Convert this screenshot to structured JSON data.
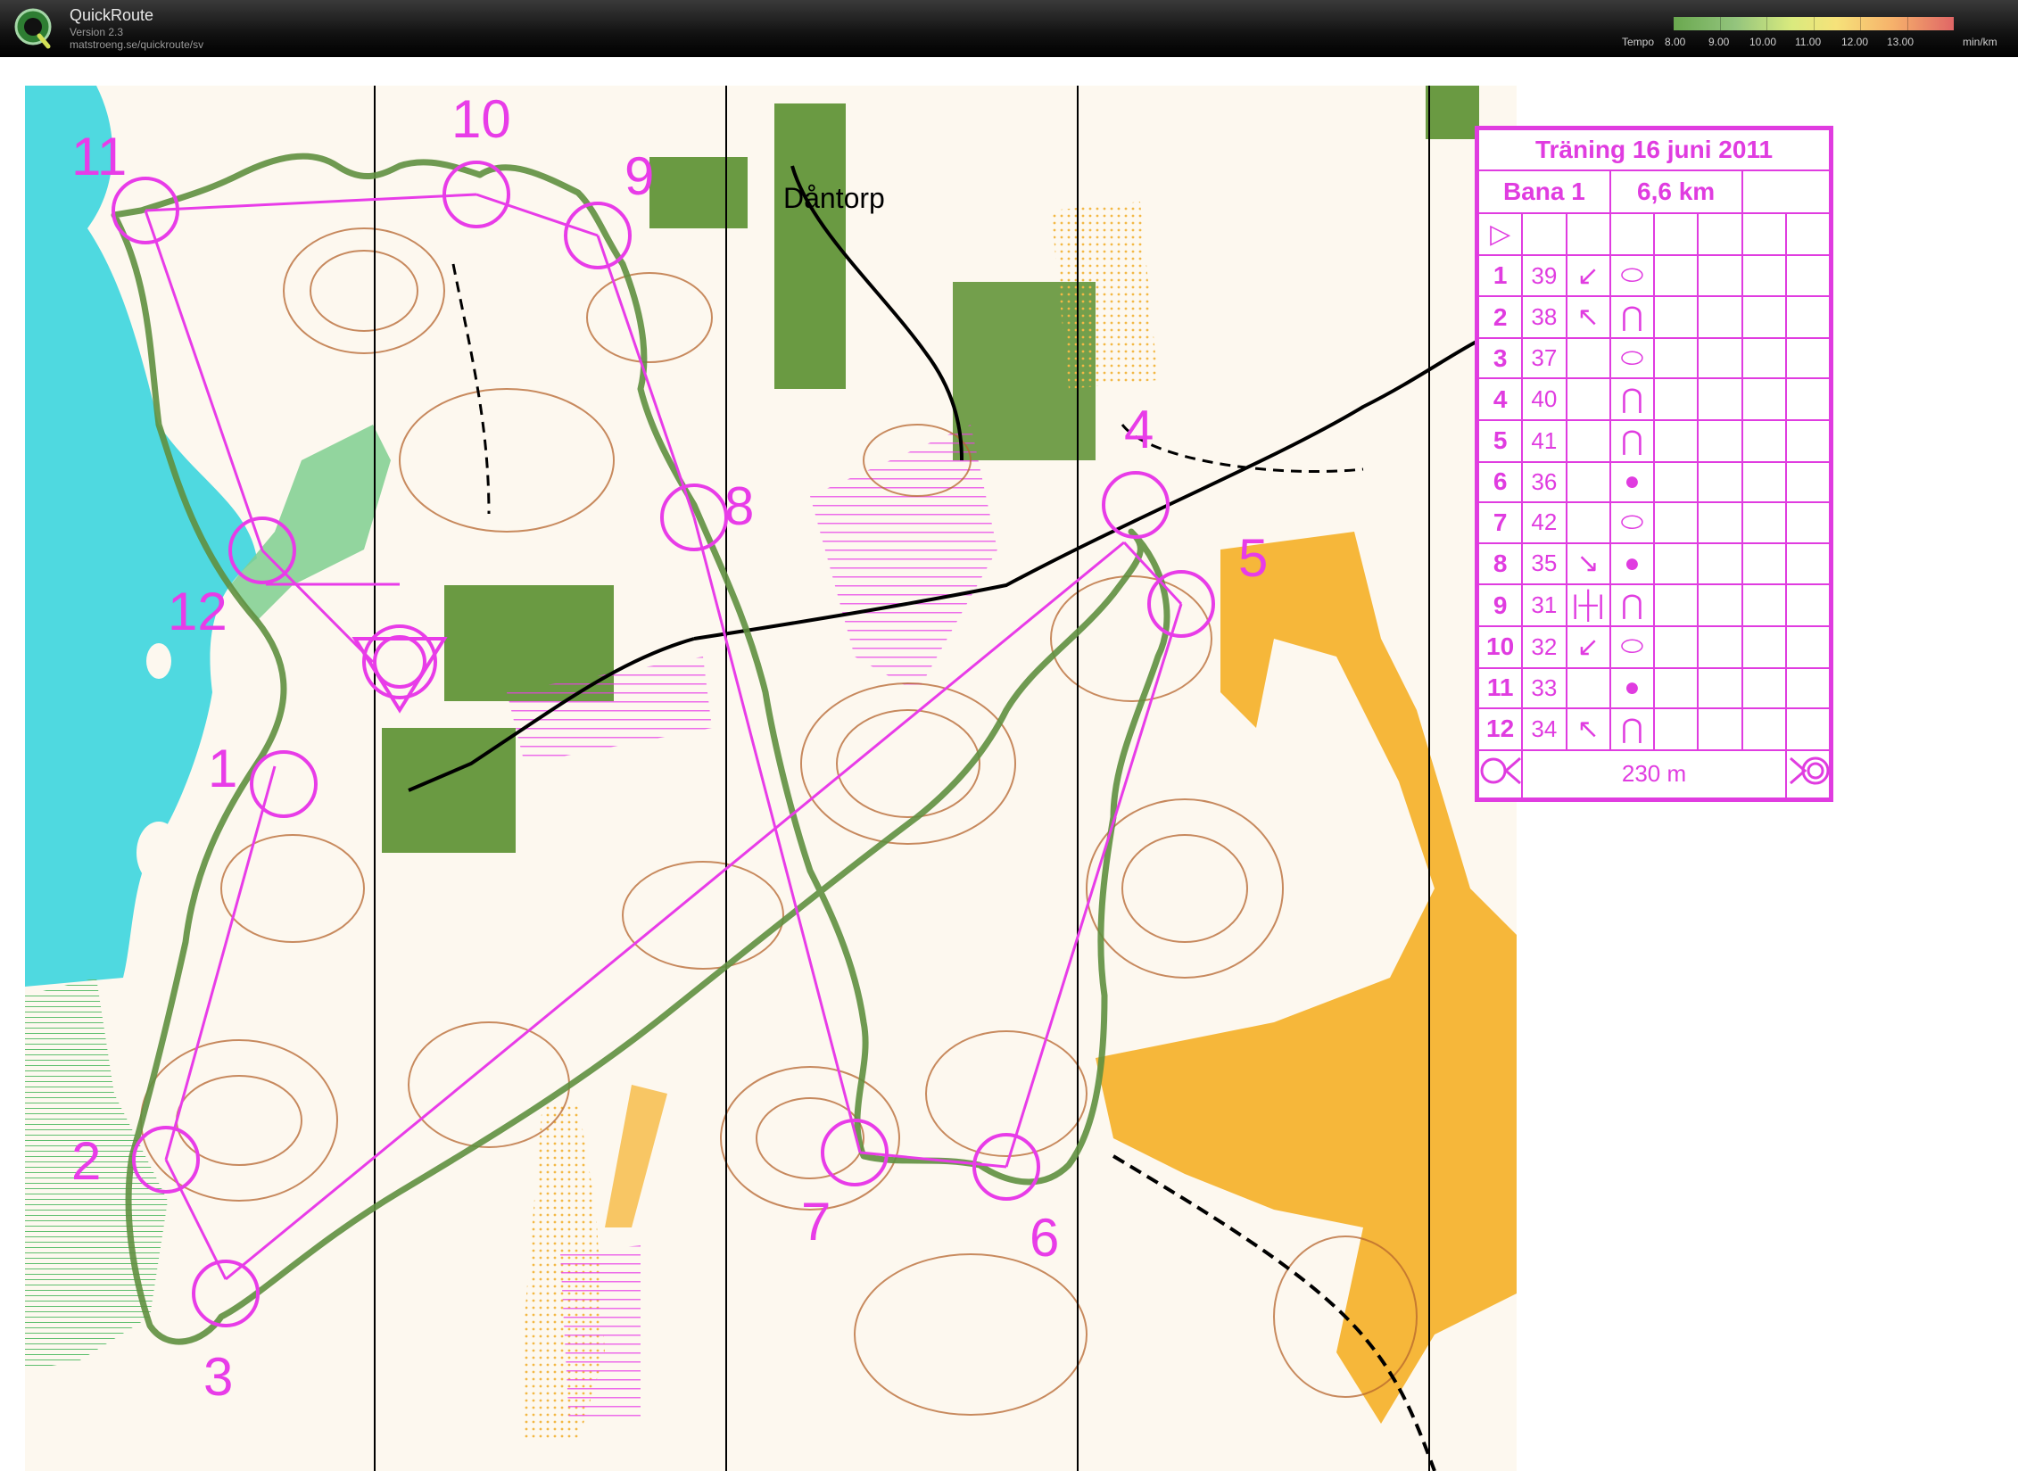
{
  "app": {
    "title": "QuickRoute",
    "version": "Version 2.3",
    "url": "matstroeng.se/quickroute/sv",
    "logo_letter": "Q"
  },
  "legend": {
    "label": "Tempo",
    "ticks": [
      "8.00",
      "9.00",
      "10.00",
      "11.00",
      "12.00",
      "13.00"
    ],
    "unit": "min/km",
    "colors": [
      "#6aa84f",
      "#93c47d",
      "#d9ea7e",
      "#f6e27a",
      "#f6b26b",
      "#e06666"
    ]
  },
  "map": {
    "place_name": "Dåntorp",
    "course_color": "#e83ce8",
    "route_color": "#5a8a3a",
    "water_color": "#4fd9e0",
    "controls": [
      {
        "label": "1"
      },
      {
        "label": "2"
      },
      {
        "label": "3"
      },
      {
        "label": "4"
      },
      {
        "label": "5"
      },
      {
        "label": "6"
      },
      {
        "label": "7"
      },
      {
        "label": "8"
      },
      {
        "label": "9"
      },
      {
        "label": "10"
      },
      {
        "label": "11"
      },
      {
        "label": "12"
      }
    ]
  },
  "description": {
    "title": "Träning 16 juni 2011",
    "course": "Bana 1",
    "length": "6,6 km",
    "start_symbol": "▷",
    "rows": [
      {
        "num": "1",
        "code": "39",
        "dir": "↙",
        "feature": "⬭"
      },
      {
        "num": "2",
        "code": "38",
        "dir": "↖",
        "feature": "⋂"
      },
      {
        "num": "3",
        "code": "37",
        "dir": "",
        "feature": "⬭"
      },
      {
        "num": "4",
        "code": "40",
        "dir": "",
        "feature": "⋂"
      },
      {
        "num": "5",
        "code": "41",
        "dir": "",
        "feature": "⋂"
      },
      {
        "num": "6",
        "code": "36",
        "dir": "",
        "feature": "●"
      },
      {
        "num": "7",
        "code": "42",
        "dir": "",
        "feature": "⬭"
      },
      {
        "num": "8",
        "code": "35",
        "dir": "↘",
        "feature": "●"
      },
      {
        "num": "9",
        "code": "31",
        "dir": "|┼|",
        "feature": "⋂"
      },
      {
        "num": "10",
        "code": "32",
        "dir": "↙",
        "feature": "⬭"
      },
      {
        "num": "11",
        "code": "33",
        "dir": "",
        "feature": "●"
      },
      {
        "num": "12",
        "code": "34",
        "dir": "↖",
        "feature": "⋂"
      }
    ],
    "finish_distance": "230 m"
  }
}
